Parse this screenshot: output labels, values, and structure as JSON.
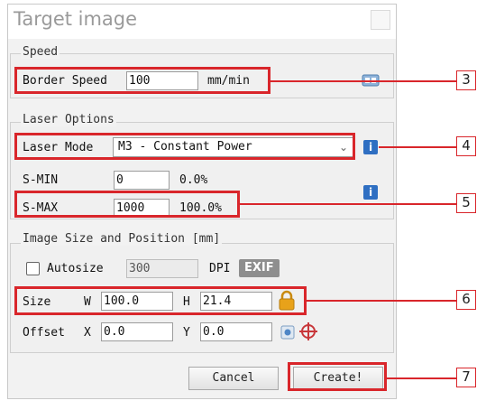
{
  "window": {
    "title": "Target image"
  },
  "speed": {
    "group_label": "Speed",
    "border_speed_label": "Border Speed",
    "border_speed_value": "100",
    "unit": "mm/min"
  },
  "laser": {
    "group_label": "Laser Options",
    "mode_label": "Laser Mode",
    "mode_value": "M3 - Constant Power",
    "smin_label": "S-MIN",
    "smin_value": "0",
    "smin_pct": "0.0%",
    "smax_label": "S-MAX",
    "smax_value": "1000",
    "smax_pct": "100.0%",
    "info_glyph": "i"
  },
  "image": {
    "group_label": "Image Size and Position [mm]",
    "autosize_label": "Autosize",
    "autosize_checked": false,
    "dpi_value": "300",
    "dpi_label": "DPI",
    "exif_label": "EXIF",
    "size_label": "Size",
    "w_label": "W",
    "w_value": "100.0",
    "h_label": "H",
    "h_value": "21.4",
    "offset_label": "Offset",
    "x_label": "X",
    "x_value": "0.0",
    "y_label": "Y",
    "y_value": "0.0"
  },
  "buttons": {
    "cancel": "Cancel",
    "create": "Create!"
  },
  "callouts": [
    "3",
    "4",
    "5",
    "6",
    "7"
  ],
  "colors": {
    "highlight": "#d9262b",
    "info": "#2f6fc2",
    "lock": "#e8a21a"
  },
  "icons": [
    "close-icon",
    "speed-help-icon",
    "chevron-down-icon",
    "info-icon",
    "lock-icon",
    "center-icon",
    "crosshair-icon"
  ]
}
